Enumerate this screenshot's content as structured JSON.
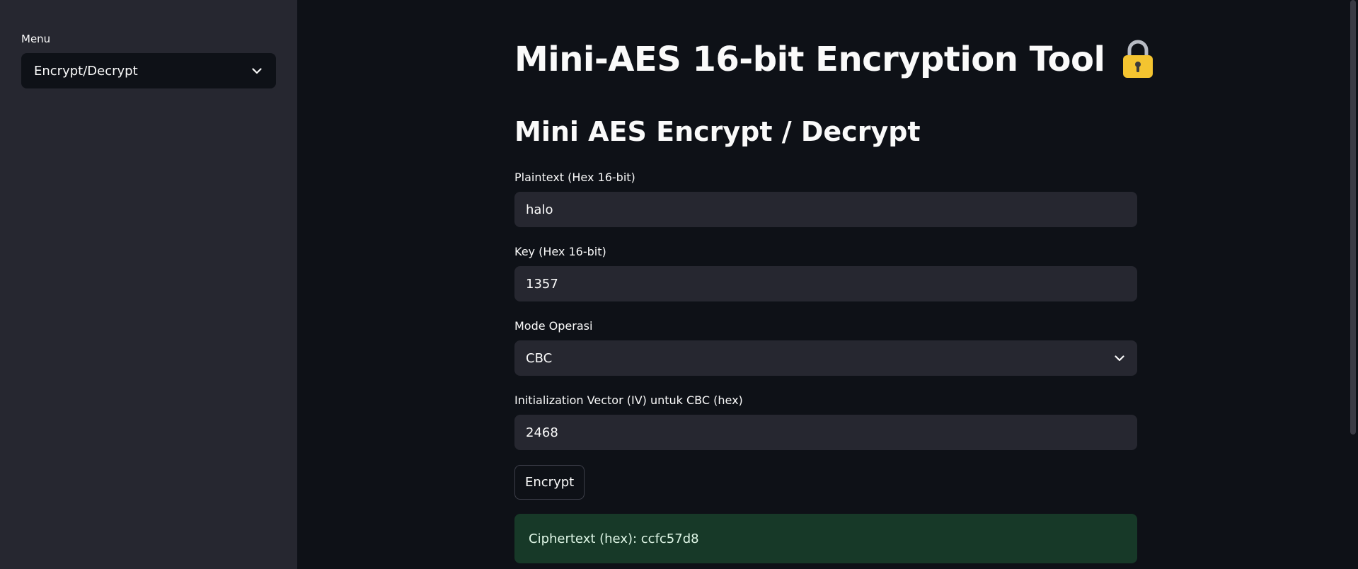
{
  "sidebar": {
    "menu_label": "Menu",
    "menu_selected": "Encrypt/Decrypt"
  },
  "main": {
    "title": "Mini-AES 16-bit Encryption Tool",
    "title_icon": "lock-icon",
    "subtitle": "Mini AES Encrypt / Decrypt",
    "plaintext": {
      "label": "Plaintext (Hex 16-bit)",
      "value": "halo"
    },
    "key": {
      "label": "Key (Hex 16-bit)",
      "value": "1357"
    },
    "mode": {
      "label": "Mode Operasi",
      "selected": "CBC"
    },
    "iv": {
      "label": "Initialization Vector (IV) untuk CBC (hex)",
      "value": "2468"
    },
    "encrypt_button": "Encrypt",
    "result_text": "Ciphertext (hex): ccfc57d8"
  },
  "colors": {
    "sidebar_bg": "#262730",
    "main_bg": "#0e1117",
    "input_bg": "#262730",
    "success_bg": "#173928",
    "lock_color": "#f4c430"
  }
}
